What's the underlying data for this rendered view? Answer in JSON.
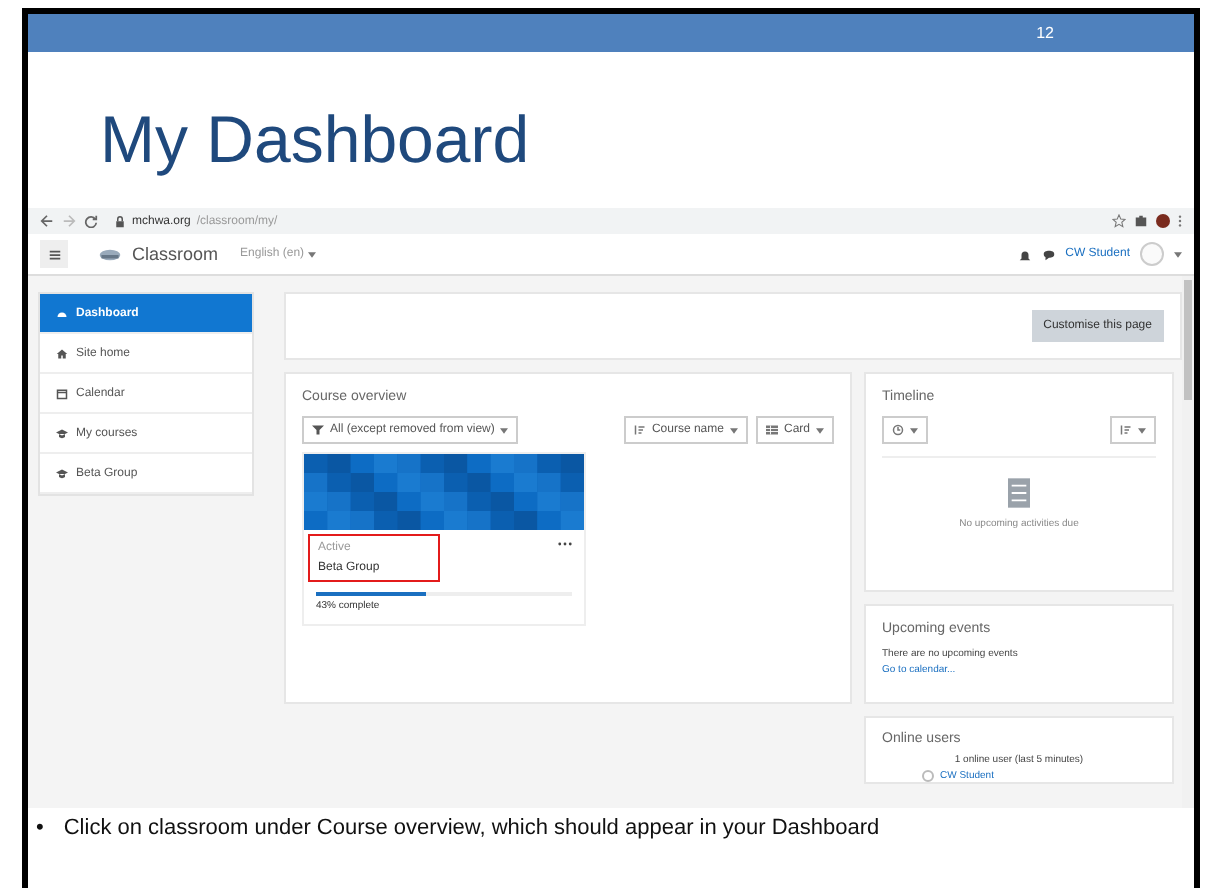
{
  "slide": {
    "page_number": "12",
    "title": "My Dashboard",
    "bullet": "•",
    "caption": "Click on classroom under Course overview, which should appear in your Dashboard"
  },
  "browser": {
    "url_domain": "mchwa.org",
    "url_path": "/classroom/my/"
  },
  "navbar": {
    "brand": "Classroom",
    "language": "English (en)",
    "user": "CW Student"
  },
  "sidebar": {
    "items": [
      {
        "label": "Dashboard",
        "kind": "dashboard",
        "selected": true
      },
      {
        "label": "Site home",
        "kind": "home",
        "selected": false
      },
      {
        "label": "Calendar",
        "kind": "calendar",
        "selected": false
      },
      {
        "label": "My courses",
        "kind": "courses",
        "selected": false
      },
      {
        "label": "Beta Group",
        "kind": "courses",
        "selected": false
      }
    ]
  },
  "header": {
    "button": "Customise this page"
  },
  "course_overview": {
    "title": "Course overview",
    "filter": "All (except removed from view)",
    "sort": "Course name",
    "view": "Card",
    "course": {
      "status": "Active",
      "name": "Beta Group",
      "highlighted": true,
      "level": 0.43,
      "progress_text": "43% complete"
    }
  },
  "timeline": {
    "title": "Timeline",
    "empty_text": "No upcoming activities due"
  },
  "upcoming_events": {
    "title": "Upcoming events",
    "text": "There are no upcoming events",
    "link": "Go to calendar..."
  },
  "online_users": {
    "title": "Online users",
    "summary": "1 online user (last 5 minutes)",
    "users": [
      "CW Student"
    ]
  }
}
